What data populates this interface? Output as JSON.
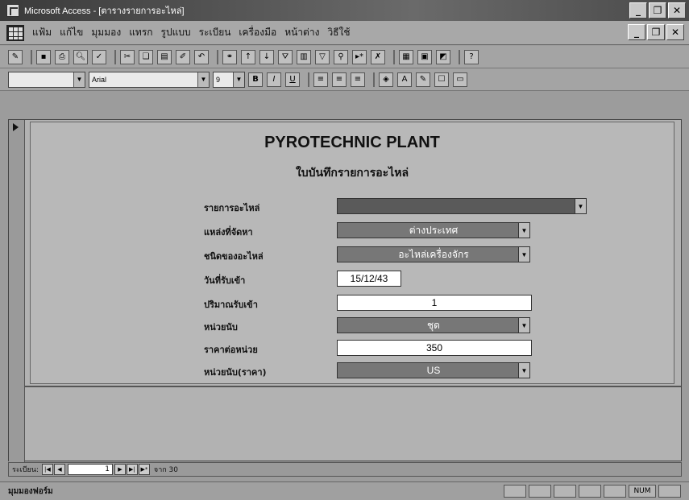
{
  "window": {
    "title": "Microsoft Access - [ตารางรายการอะไหล่]"
  },
  "menu": {
    "items": [
      "แฟ้ม",
      "แก้ไข",
      "มุมมอง",
      "แทรก",
      "รูปแบบ",
      "ระเบียน",
      "เครื่องมือ",
      "หน้าต่าง",
      "วิธีใช้"
    ]
  },
  "format_toolbar": {
    "font": "Arial",
    "size": "9"
  },
  "form": {
    "title": "PYROTECHNIC PLANT",
    "subtitle": "ใบบันทึกรายการอะไหล่",
    "fields": [
      {
        "label": "รายการอะไหล่",
        "value": ""
      },
      {
        "label": "แหล่งที่จัดหา",
        "value": "ต่างประเทศ"
      },
      {
        "label": "ชนิดของอะไหล่",
        "value": "อะไหล่เครื่องจักร"
      },
      {
        "label": "วันที่รับเข้า",
        "value": "15/12/43"
      },
      {
        "label": "ปริมาณรับเข้า",
        "value": "1"
      },
      {
        "label": "หน่วยนับ",
        "value": "ชุด"
      },
      {
        "label": "ราคาต่อหน่วย",
        "value": "350"
      },
      {
        "label": "หน่วยนับ(ราคา)",
        "value": "US"
      }
    ]
  },
  "record_nav": {
    "label": "ระเบียน:",
    "current": "1",
    "of_label": "จาก 30"
  },
  "status": {
    "text": "มุมมองฟอร์ม",
    "num": "NUM"
  }
}
